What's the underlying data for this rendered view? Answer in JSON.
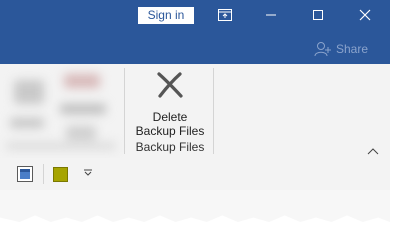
{
  "titlebar": {
    "sign_in_label": "Sign in",
    "share_label": "Share",
    "buttons": [
      "ribbon-display-options-icon",
      "minimize-icon",
      "maximize-icon",
      "close-icon"
    ]
  },
  "ribbon": {
    "delete_backup_button": {
      "line1": "Delete",
      "line2": "Backup Files",
      "icon": "x-delete-icon"
    },
    "group_label": "Backup Files",
    "collapse_icon": "chevron-up-icon"
  },
  "quick_access": {
    "items": [
      "view-layout-icon",
      "color-swatch-icon",
      "customize-dropdown-icon"
    ]
  },
  "colors": {
    "title_bar": "#2b579a",
    "ribbon_bg": "#f3f3f3",
    "swatch": "#a6a400"
  }
}
